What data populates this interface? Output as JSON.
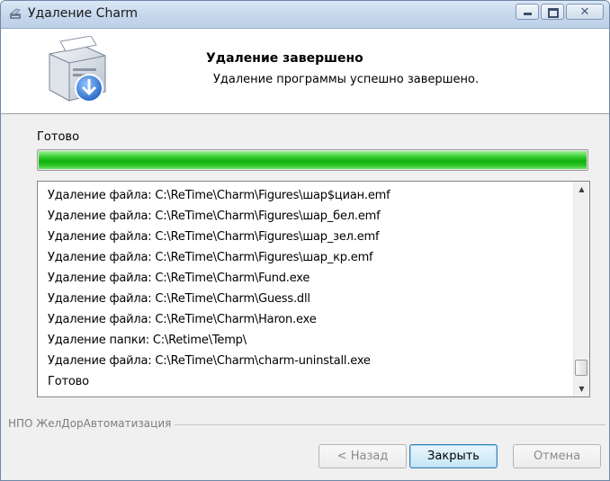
{
  "window": {
    "title": "Удаление Charm"
  },
  "header": {
    "title": "Удаление завершено",
    "subtitle": "Удаление программы успешно завершено."
  },
  "status": {
    "label": "Готово",
    "progress_percent": 100,
    "progress_color": "#1fbf1a"
  },
  "log": {
    "lines": [
      "Удаление файла: C:\\ReTime\\Charm\\Figures\\шар$циан.emf",
      "Удаление файла: C:\\ReTime\\Charm\\Figures\\шар_бел.emf",
      "Удаление файла: C:\\ReTime\\Charm\\Figures\\шар_зел.emf",
      "Удаление файла: C:\\ReTime\\Charm\\Figures\\шар_кр.emf",
      "Удаление файла: C:\\ReTime\\Charm\\Fund.exe",
      "Удаление файла: C:\\ReTime\\Charm\\Guess.dll",
      "Удаление файла: C:\\ReTime\\Charm\\Haron.exe",
      "Удаление папки: C:\\Retime\\Temp\\",
      "Удаление файла: C:\\ReTime\\Charm\\charm-uninstall.exe",
      "Готово"
    ]
  },
  "footer": {
    "brand": "НПО ЖелДорАвтоматизация",
    "back_label": "< Назад",
    "close_label": "Закрыть",
    "cancel_label": "Отмена"
  }
}
